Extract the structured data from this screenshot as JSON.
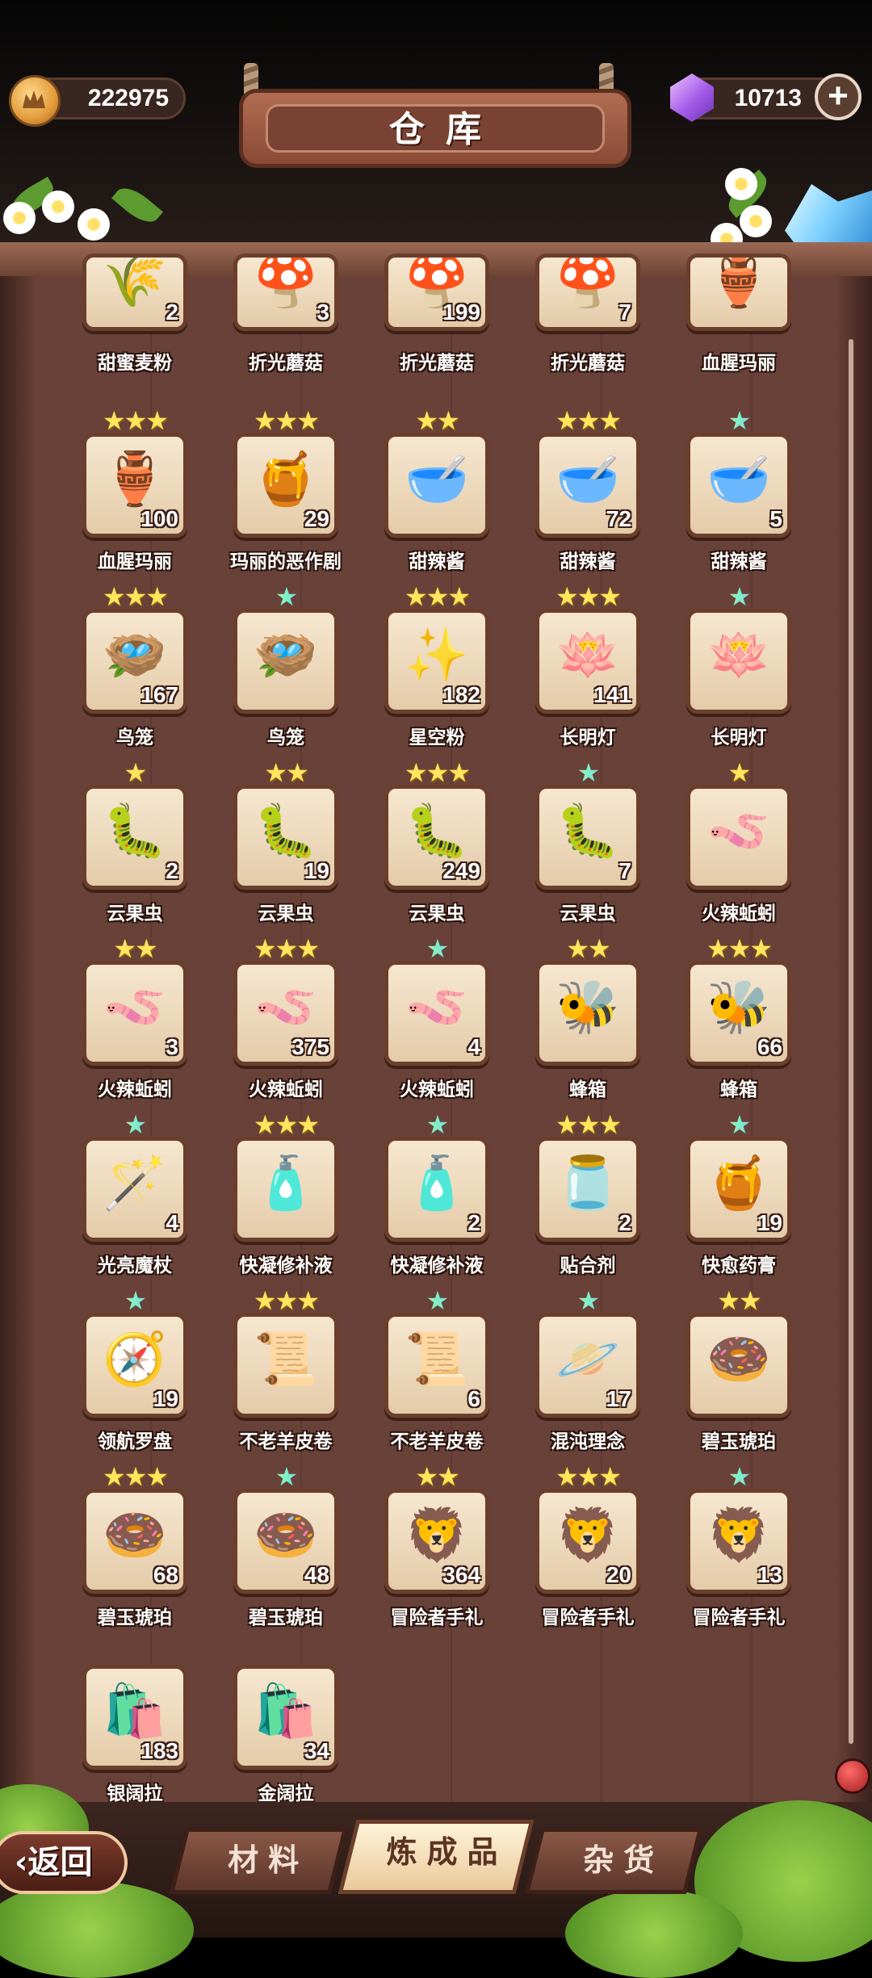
{
  "header": {
    "title": "仓库",
    "coins": "222975",
    "gems": "10713",
    "add_icon": "plus-icon"
  },
  "items": [
    {
      "name": "甜蜜麦粉",
      "count": "2",
      "stars": 0,
      "rainbow": false,
      "icon": "flour-sack-icon",
      "glyph": "🌾"
    },
    {
      "name": "折光蘑菇",
      "count": "3",
      "stars": 0,
      "rainbow": false,
      "icon": "blue-mushroom-icon",
      "glyph": "🍄"
    },
    {
      "name": "折光蘑菇",
      "count": "199",
      "stars": 0,
      "rainbow": false,
      "icon": "blue-mushroom-icon",
      "glyph": "🍄"
    },
    {
      "name": "折光蘑菇",
      "count": "7",
      "stars": 0,
      "rainbow": false,
      "icon": "blue-mushroom-icon",
      "glyph": "🍄"
    },
    {
      "name": "血腥玛丽",
      "count": "",
      "stars": 0,
      "rainbow": false,
      "icon": "skull-jar-icon",
      "glyph": "🏺"
    },
    {
      "name": "血腥玛丽",
      "count": "100",
      "stars": 3,
      "rainbow": false,
      "icon": "skull-jar-icon",
      "glyph": "🏺"
    },
    {
      "name": "玛丽的恶作剧",
      "count": "29",
      "stars": 3,
      "rainbow": false,
      "icon": "red-jam-jar-icon",
      "glyph": "🍯"
    },
    {
      "name": "甜辣酱",
      "count": "",
      "stars": 2,
      "rainbow": false,
      "icon": "chili-sauce-plate-icon",
      "glyph": "🥣"
    },
    {
      "name": "甜辣酱",
      "count": "72",
      "stars": 3,
      "rainbow": false,
      "icon": "chili-sauce-plate-icon",
      "glyph": "🥣"
    },
    {
      "name": "甜辣酱",
      "count": "5",
      "stars": 1,
      "rainbow": true,
      "icon": "chili-sauce-plate-icon",
      "glyph": "🥣"
    },
    {
      "name": "鸟笼",
      "count": "167",
      "stars": 3,
      "rainbow": false,
      "icon": "birdcage-icon",
      "glyph": "🪺"
    },
    {
      "name": "鸟笼",
      "count": "",
      "stars": 1,
      "rainbow": true,
      "icon": "birdcage-icon",
      "glyph": "🪺"
    },
    {
      "name": "星空粉",
      "count": "182",
      "stars": 3,
      "rainbow": false,
      "icon": "starry-powder-icon",
      "glyph": "✨"
    },
    {
      "name": "长明灯",
      "count": "141",
      "stars": 3,
      "rainbow": false,
      "icon": "lotus-lamp-icon",
      "glyph": "🪷"
    },
    {
      "name": "长明灯",
      "count": "",
      "stars": 1,
      "rainbow": true,
      "icon": "lotus-lamp-icon",
      "glyph": "🪷"
    },
    {
      "name": "云果虫",
      "count": "2",
      "stars": 1,
      "rainbow": false,
      "icon": "pink-worm-icon",
      "glyph": "🐛"
    },
    {
      "name": "云果虫",
      "count": "19",
      "stars": 2,
      "rainbow": false,
      "icon": "pink-worm-icon",
      "glyph": "🐛"
    },
    {
      "name": "云果虫",
      "count": "249",
      "stars": 3,
      "rainbow": false,
      "icon": "pink-worm-icon",
      "glyph": "🐛"
    },
    {
      "name": "云果虫",
      "count": "7",
      "stars": 1,
      "rainbow": true,
      "icon": "pink-worm-icon",
      "glyph": "🐛"
    },
    {
      "name": "火辣蚯蚓",
      "count": "",
      "stars": 1,
      "rainbow": false,
      "icon": "spicy-earthworm-icon",
      "glyph": "🪱"
    },
    {
      "name": "火辣蚯蚓",
      "count": "3",
      "stars": 2,
      "rainbow": false,
      "icon": "spicy-earthworm-icon",
      "glyph": "🪱"
    },
    {
      "name": "火辣蚯蚓",
      "count": "375",
      "stars": 3,
      "rainbow": false,
      "icon": "spicy-earthworm-icon",
      "glyph": "🪱"
    },
    {
      "name": "火辣蚯蚓",
      "count": "4",
      "stars": 1,
      "rainbow": true,
      "icon": "spicy-earthworm-icon",
      "glyph": "🪱"
    },
    {
      "name": "蜂箱",
      "count": "",
      "stars": 2,
      "rainbow": false,
      "icon": "beehive-icon",
      "glyph": "🐝"
    },
    {
      "name": "蜂箱",
      "count": "66",
      "stars": 3,
      "rainbow": false,
      "icon": "beehive-icon",
      "glyph": "🐝"
    },
    {
      "name": "光亮魔杖",
      "count": "4",
      "stars": 1,
      "rainbow": true,
      "icon": "magic-wand-icon",
      "glyph": "🪄"
    },
    {
      "name": "快凝修补液",
      "count": "",
      "stars": 3,
      "rainbow": false,
      "icon": "repair-tube-icon",
      "glyph": "🧴"
    },
    {
      "name": "快凝修补液",
      "count": "2",
      "stars": 1,
      "rainbow": true,
      "icon": "repair-tube-icon",
      "glyph": "🧴"
    },
    {
      "name": "贴合剂",
      "count": "2",
      "stars": 3,
      "rainbow": false,
      "icon": "adhesive-jar-icon",
      "glyph": "🫙"
    },
    {
      "name": "快愈药膏",
      "count": "19",
      "stars": 1,
      "rainbow": true,
      "icon": "ointment-jar-icon",
      "glyph": "🍯"
    },
    {
      "name": "领航罗盘",
      "count": "19",
      "stars": 1,
      "rainbow": true,
      "icon": "compass-icon",
      "glyph": "🧭"
    },
    {
      "name": "不老羊皮卷",
      "count": "",
      "stars": 3,
      "rainbow": false,
      "icon": "scroll-icon",
      "glyph": "📜"
    },
    {
      "name": "不老羊皮卷",
      "count": "6",
      "stars": 1,
      "rainbow": true,
      "icon": "scroll-icon",
      "glyph": "📜"
    },
    {
      "name": "混沌理念",
      "count": "17",
      "stars": 1,
      "rainbow": true,
      "icon": "black-hole-icon",
      "glyph": "🪐"
    },
    {
      "name": "碧玉琥珀",
      "count": "",
      "stars": 2,
      "rainbow": false,
      "icon": "amber-ring-icon",
      "glyph": "🍩"
    },
    {
      "name": "碧玉琥珀",
      "count": "68",
      "stars": 3,
      "rainbow": false,
      "icon": "amber-ring-icon",
      "glyph": "🍩"
    },
    {
      "name": "碧玉琥珀",
      "count": "48",
      "stars": 1,
      "rainbow": true,
      "icon": "amber-ring-icon",
      "glyph": "🍩"
    },
    {
      "name": "冒险者手礼",
      "count": "364",
      "stars": 2,
      "rainbow": false,
      "icon": "lion-statue-icon",
      "glyph": "🦁"
    },
    {
      "name": "冒险者手礼",
      "count": "20",
      "stars": 3,
      "rainbow": false,
      "icon": "lion-statue-icon",
      "glyph": "🦁"
    },
    {
      "name": "冒险者手礼",
      "count": "13",
      "stars": 1,
      "rainbow": true,
      "icon": "lion-statue-icon",
      "glyph": "🦁"
    },
    {
      "name": "银阔拉",
      "count": "183",
      "stars": 0,
      "rainbow": false,
      "icon": "white-pouch-icon",
      "glyph": "🛍️"
    },
    {
      "name": "金阔拉",
      "count": "34",
      "stars": 0,
      "rainbow": false,
      "icon": "yellow-pouch-icon",
      "glyph": "🛍️"
    }
  ],
  "tabs": [
    {
      "label": "材料",
      "active": false
    },
    {
      "label": "炼成品",
      "active": true
    },
    {
      "label": "杂货",
      "active": false
    }
  ],
  "back_label": "返回"
}
